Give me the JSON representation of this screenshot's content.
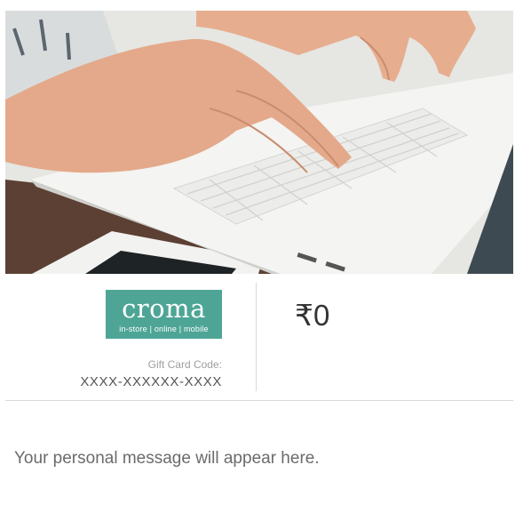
{
  "hero": {
    "image": "laptop-typing-photo"
  },
  "brand": {
    "name": "croma",
    "tagline": "in-store | online | mobile",
    "color": "#4ea596"
  },
  "gift_card": {
    "code_label": "Gift Card Code:",
    "code_value": "XXXX-XXXXXX-XXXX",
    "amount": "₹0"
  },
  "message": {
    "text": "Your personal message will appear here."
  }
}
